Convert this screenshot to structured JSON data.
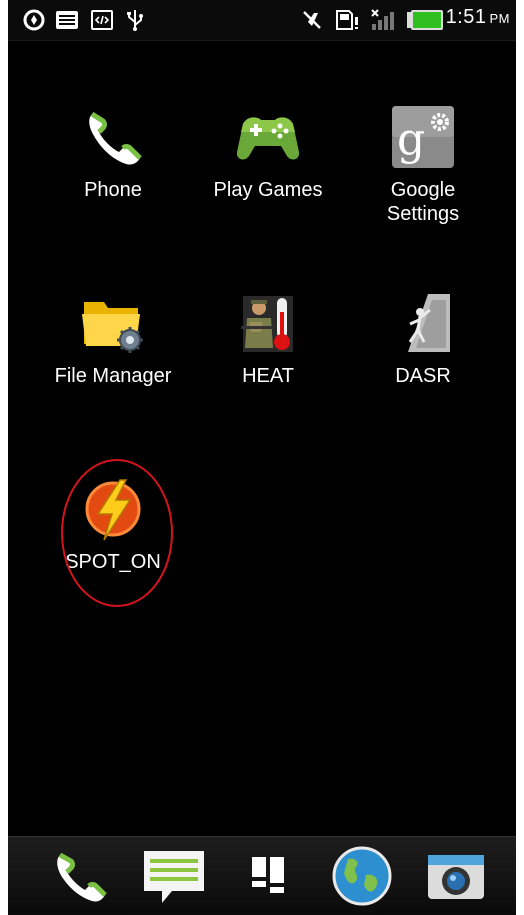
{
  "status_bar": {
    "time": "1:51",
    "ampm": "PM",
    "left_icons": [
      "sync-icon",
      "storage-icon",
      "code-icon",
      "usb-icon"
    ],
    "right_icons": [
      "mute-icon",
      "sd-card-alert-icon",
      "signal-icon",
      "battery-icon"
    ]
  },
  "apps": [
    {
      "label": "Phone",
      "icon": "phone-icon"
    },
    {
      "label": "Play Games",
      "icon": "gamepad-icon"
    },
    {
      "label": "Google Settings",
      "icon": "google-settings-icon"
    },
    {
      "label": "File Manager",
      "icon": "folder-gear-icon"
    },
    {
      "label": "HEAT",
      "icon": "soldier-thermometer-icon"
    },
    {
      "label": "DASR",
      "icon": "climber-icon"
    },
    {
      "label": "SPOT_ON",
      "icon": "lightning-icon",
      "highlighted": true
    }
  ],
  "dock": [
    "phone-icon",
    "messages-icon",
    "apps-grid-icon",
    "browser-globe-icon",
    "camera-icon"
  ],
  "colors": {
    "background": "#000000",
    "highlight_ring": "#d4141c",
    "phone_green": "#7ac143"
  }
}
